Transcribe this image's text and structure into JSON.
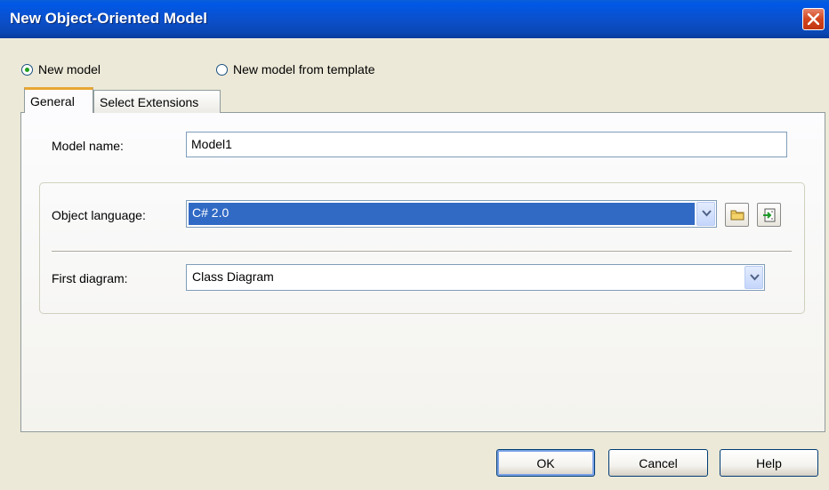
{
  "window": {
    "title": "New Object-Oriented Model"
  },
  "mode": {
    "new_model_label": "New model",
    "new_model_selected": true,
    "template_label": "New model from template",
    "template_selected": false
  },
  "tabs": [
    {
      "label": "General",
      "active": true
    },
    {
      "label": "Select Extensions",
      "active": false
    }
  ],
  "general": {
    "model_name_label": "Model name:",
    "model_name_value": "Model1",
    "object_language_label": "Object language:",
    "object_language_value": "C# 2.0",
    "first_diagram_label": "First diagram:",
    "first_diagram_value": "Class Diagram"
  },
  "icons": {
    "close": "close-icon",
    "dropdown": "chevron-down-icon",
    "browse": "folder-icon",
    "import": "import-icon"
  },
  "buttons": {
    "ok": "OK",
    "cancel": "Cancel",
    "help": "Help"
  },
  "colors": {
    "titlebar": "#0b4fc9",
    "selection": "#316ac5",
    "tab_highlight": "#e8a633",
    "close_button": "#d2461f"
  }
}
